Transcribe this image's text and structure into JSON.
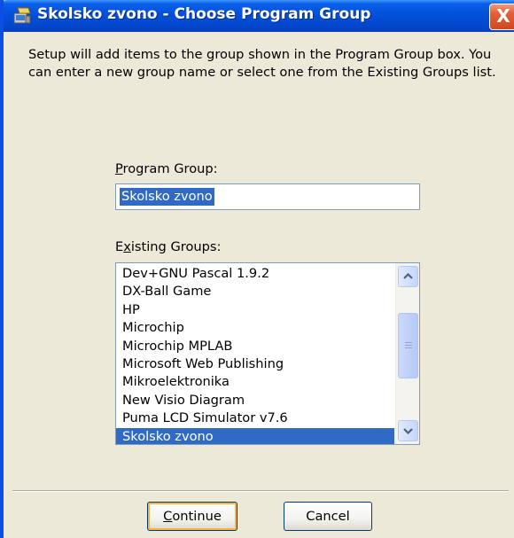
{
  "window": {
    "title": "Skolsko zvono - Choose Program Group",
    "close_label": "X"
  },
  "description": "Setup will add items to the group shown in the Program Group box. You can enter a new group name or select one from the Existing Groups list.",
  "program_group": {
    "label_prefix": "",
    "label_accel": "P",
    "label_rest": "rogram Group:",
    "value": "Skolsko zvono"
  },
  "existing_groups": {
    "label_prefix": "E",
    "label_accel": "x",
    "label_rest": "isting Groups:",
    "items": [
      "Dev+GNU Pascal 1.9.2",
      "DX-Ball Game",
      "HP",
      "Microchip",
      "Microchip MPLAB",
      "Microsoft Web Publishing",
      "Mikroelektronika",
      "New Visio Diagram",
      "Puma LCD Simulator v7.6",
      "Skolsko zvono"
    ],
    "selected": "Skolsko zvono"
  },
  "buttons": {
    "continue_accel": "C",
    "continue_rest": "ontinue",
    "cancel": "Cancel"
  },
  "icons": {
    "title_icon": "setup-icon",
    "scroll_up": "chevron-up-icon",
    "scroll_down": "chevron-down-icon"
  },
  "colors": {
    "titlebar": "#0350d9",
    "selection": "#316ac5",
    "close": "#d2481f",
    "dialog_bg": "#ece9d8"
  }
}
